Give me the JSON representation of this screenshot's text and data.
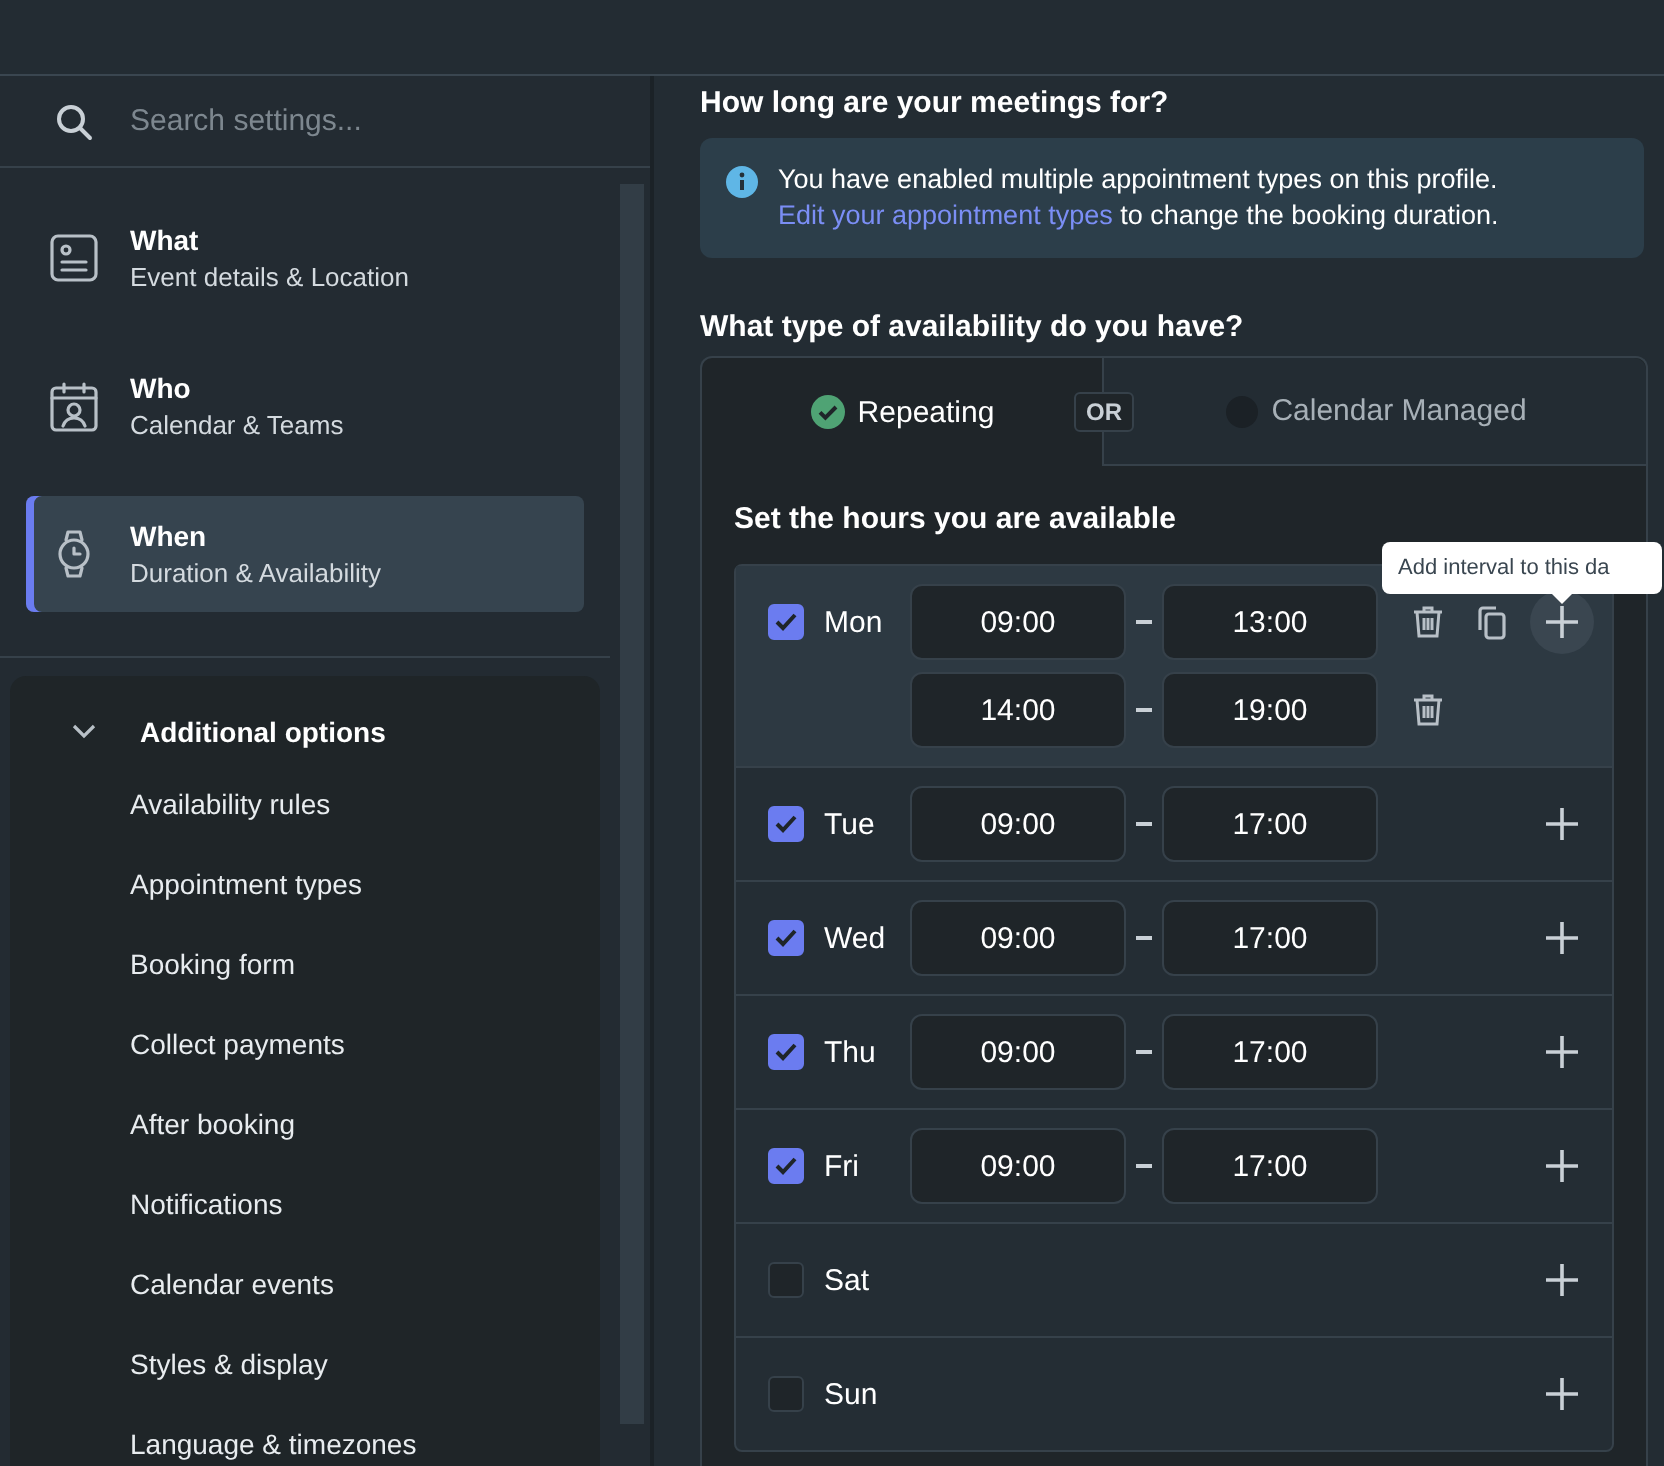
{
  "sidebar": {
    "search": {
      "placeholder": "Search settings..."
    },
    "nav": [
      {
        "title": "What",
        "subtitle": "Event details & Location",
        "selected": false
      },
      {
        "title": "Who",
        "subtitle": "Calendar & Teams",
        "selected": false
      },
      {
        "title": "When",
        "subtitle": "Duration & Availability",
        "selected": true
      }
    ],
    "additional": {
      "title": "Additional options",
      "expanded": true,
      "items": [
        "Availability rules",
        "Appointment types",
        "Booking form",
        "Collect payments",
        "After booking",
        "Notifications",
        "Calendar events",
        "Styles & display",
        "Language & timezones"
      ]
    }
  },
  "main": {
    "duration": {
      "heading": "How long are your meetings for?",
      "info": "You have enabled multiple appointment types on this profile.",
      "link": "Edit your appointment types",
      "info_rest": " to change the booking duration."
    },
    "availability": {
      "heading": "What type of availability do you have?",
      "tabs": [
        {
          "label": "Repeating",
          "selected": true
        },
        {
          "label": "Calendar Managed",
          "selected": false
        }
      ],
      "separator": "OR",
      "hours_heading": "Set the hours you are available",
      "days": [
        {
          "day": "Mon",
          "checked": true,
          "hovered": true,
          "intervals": [
            {
              "start": "09:00",
              "end": "13:00"
            },
            {
              "start": "14:00",
              "end": "19:00"
            }
          ]
        },
        {
          "day": "Tue",
          "checked": true,
          "hovered": false,
          "intervals": [
            {
              "start": "09:00",
              "end": "17:00"
            }
          ]
        },
        {
          "day": "Wed",
          "checked": true,
          "hovered": false,
          "intervals": [
            {
              "start": "09:00",
              "end": "17:00"
            }
          ]
        },
        {
          "day": "Thu",
          "checked": true,
          "hovered": false,
          "intervals": [
            {
              "start": "09:00",
              "end": "17:00"
            }
          ]
        },
        {
          "day": "Fri",
          "checked": true,
          "hovered": false,
          "intervals": [
            {
              "start": "09:00",
              "end": "17:00"
            }
          ]
        },
        {
          "day": "Sat",
          "checked": false,
          "hovered": false
        },
        {
          "day": "Sun",
          "checked": false,
          "hovered": false
        }
      ],
      "tooltip": "Add interval to this da"
    }
  }
}
